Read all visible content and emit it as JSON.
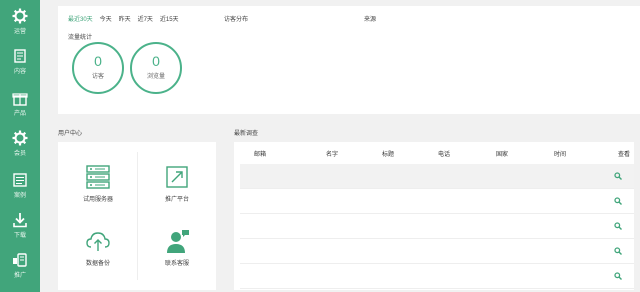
{
  "sidebar": {
    "items": [
      {
        "label": "运营",
        "icon": "gear-icon"
      },
      {
        "label": "内容",
        "icon": "document-edit-icon"
      },
      {
        "label": "产品",
        "icon": "gift-box-icon"
      },
      {
        "label": "会员",
        "icon": "gear-icon"
      },
      {
        "label": "案例",
        "icon": "case-list-icon"
      },
      {
        "label": "下载",
        "icon": "download-icon"
      },
      {
        "label": "推广",
        "icon": "promotion-icon"
      }
    ]
  },
  "stats": {
    "ranges": [
      "最近30天",
      "今天",
      "昨天",
      "近7天",
      "近15天"
    ],
    "active_range": "最近30天",
    "traffic_title": "流量统计",
    "visitors": {
      "value": "0",
      "label": "访客"
    },
    "pageviews": {
      "value": "0",
      "label": "浏览量"
    },
    "distribution_title": "访客分布",
    "source_title": "来源"
  },
  "user_center": {
    "title": "用户中心",
    "tiles": [
      {
        "label": "试用服务器",
        "icon": "server-icon"
      },
      {
        "label": "推广平台",
        "icon": "share-arrow-icon"
      },
      {
        "label": "数据备份",
        "icon": "cloud-upload-icon"
      },
      {
        "label": "联系客服",
        "icon": "customer-service-icon"
      }
    ]
  },
  "survey": {
    "title": "最新调查",
    "columns": [
      "邮箱",
      "名字",
      "标题",
      "电话",
      "国家",
      "时间",
      "查看"
    ],
    "rows": 5
  },
  "colors": {
    "brand": "#41a57b",
    "ring": "#4bb28a"
  }
}
